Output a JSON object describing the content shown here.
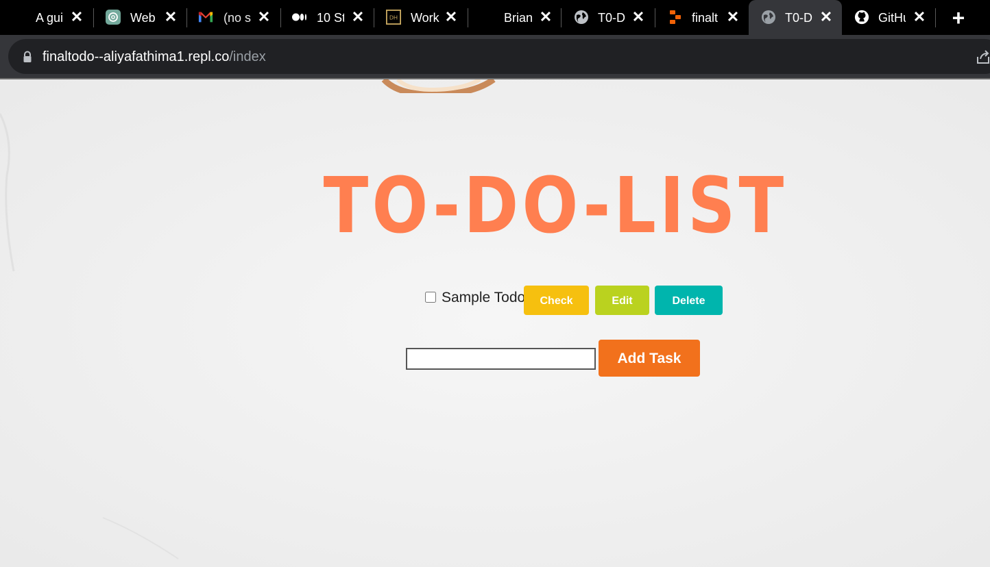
{
  "browser": {
    "tabs": [
      {
        "title": "A gui",
        "icon": "ai-guide-favicon",
        "active": false
      },
      {
        "title": "Web",
        "icon": "openai-icon",
        "active": false
      },
      {
        "title": "(no s",
        "icon": "gmail-icon",
        "active": false
      },
      {
        "title": "10 St",
        "icon": "medium-icon",
        "active": false
      },
      {
        "title": "Work",
        "icon": "dh-icon",
        "active": false
      },
      {
        "title": "Brian",
        "icon": "none",
        "active": false
      },
      {
        "title": "T0-D",
        "icon": "globe-icon",
        "active": false
      },
      {
        "title": "finalt",
        "icon": "replit-icon",
        "active": false
      },
      {
        "title": "T0-D",
        "icon": "globe-icon",
        "active": true
      },
      {
        "title": "GitHu",
        "icon": "github-icon",
        "active": false
      }
    ],
    "close_glyph": "✕",
    "new_tab_glyph": "+",
    "url_host": "finaltodo--aliyafathima1.repl.co",
    "url_path": "/index",
    "colors": {
      "tabbar_bg": "#000000",
      "active_tab_bg": "#35363a",
      "omnibox_bg": "#202124"
    }
  },
  "app": {
    "heading": "TO-DO-LIST",
    "heading_color": "#ff7f50",
    "todos": [
      {
        "text": "Sample Todo",
        "checked": false
      }
    ],
    "buttons": {
      "check": "Check",
      "edit": "Edit",
      "delete": "Delete",
      "add_task": "Add Task"
    },
    "input_value": "",
    "colors": {
      "check": "#f6c00f",
      "edit": "#bad21f",
      "delete": "#00b5ad",
      "add_task": "#f2711c"
    }
  }
}
